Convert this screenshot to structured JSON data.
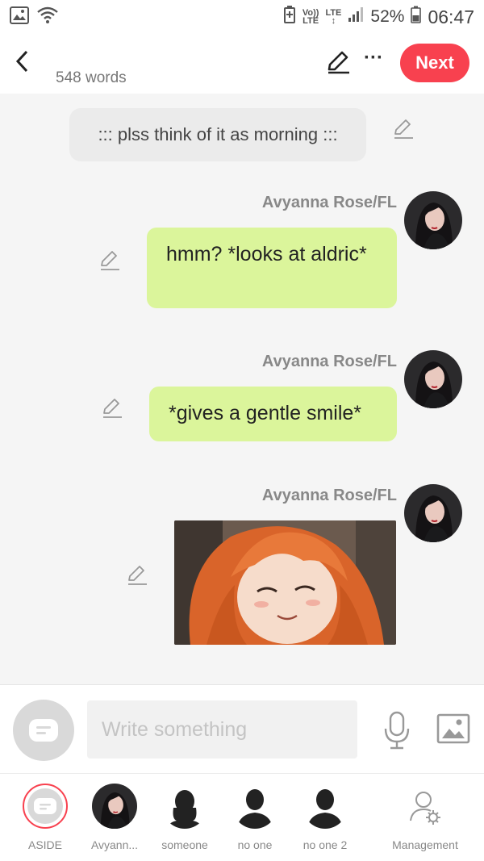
{
  "status": {
    "signal_small_top": "Vo))",
    "signal_small_bottom": "LTE",
    "lte_top": "LTE",
    "lte_bottom": "↕",
    "battery": "52%",
    "time": "06:47"
  },
  "topbar": {
    "word_count": "548 words",
    "more": "···",
    "next_label": "Next"
  },
  "chat": {
    "narration": "::: plss think of it as morning :::",
    "messages": [
      {
        "sender": "Avyanna Rose/FL",
        "text": "hmm? *looks at aldric*"
      },
      {
        "sender": "Avyanna Rose/FL",
        "text": "*gives a gentle smile*"
      },
      {
        "sender": "Avyanna Rose/FL",
        "image": "anime-girl-smiling-image"
      }
    ]
  },
  "composer": {
    "placeholder": "Write something"
  },
  "characters": [
    {
      "label": "ASIDE",
      "icon": "aside-icon"
    },
    {
      "label": "Avyann..."
    },
    {
      "label": "someone",
      "icon": "silhouette-icon"
    },
    {
      "label": "no one",
      "icon": "silhouette-icon"
    },
    {
      "label": "no one 2",
      "icon": "silhouette-icon"
    },
    {
      "label": "Management",
      "icon": "user-gear-icon"
    }
  ],
  "colors": {
    "accent": "#f8414f",
    "bubble": "#dbf59b"
  }
}
